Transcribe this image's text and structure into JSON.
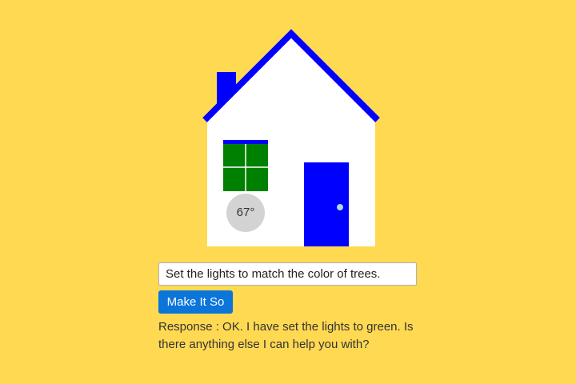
{
  "house": {
    "thermostat_temperature": "67°",
    "lights_color": "#008000",
    "wall_color": "#ffffff",
    "trim_color": "#0000ff",
    "door_knob_color": "#add8e6",
    "thermostat_color": "#d3d3d3"
  },
  "command": {
    "value": "Set the lights to match the color of trees."
  },
  "submit": {
    "label": "Make It So"
  },
  "response": {
    "prefix": "Response : ",
    "text": "OK. I have set the lights to green. Is there anything else I can help you with?"
  }
}
